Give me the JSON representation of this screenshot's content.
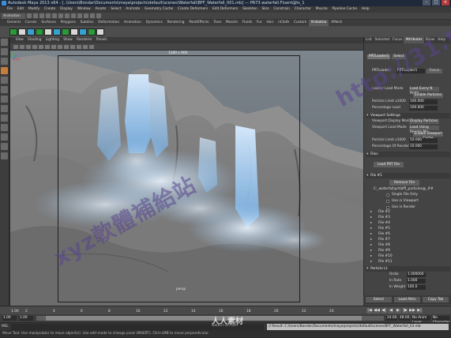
{
  "window": {
    "title": "Autodesk Maya 2013 x64 - [..\\Users\\Bondar\\Documents\\maya\\projects\\default\\scenes\\Waterfall\\BFF_Waterfall_001.mb] --- PR73.waterfall.Fluent@ts_1"
  },
  "menubar": [
    "File",
    "Edit",
    "Modify",
    "Create",
    "Display",
    "Window",
    "Assets",
    "Select",
    "Animate",
    "Geometry Cache",
    "Create Deformers",
    "Edit Deformers",
    "Skeleton",
    "Skin",
    "Constrain",
    "Character",
    "Muscle",
    "Pipeline Cache",
    "Help"
  ],
  "status_line": {
    "mode": "Animation"
  },
  "shelf_tabs": {
    "items": [
      "General",
      "Curves",
      "Surfaces",
      "Polygons",
      "Subdivs",
      "Deformation",
      "Animation",
      "Dynamics",
      "Rendering",
      "PaintEffects",
      "Toon",
      "Muscle",
      "Fluids",
      "Fur",
      "Hair",
      "nCloth",
      "Custom",
      "Krakatoa",
      "XMesh"
    ],
    "active_index": 17
  },
  "shelf_icon_colors": [
    "#2a9a3a",
    "#d8d8d8",
    "#3aa0d0",
    "#2a9a3a",
    "#d8d8d8",
    "#3aa0d0",
    "#2a9a3a",
    "#d8d8d8",
    "#3aa0d0",
    "#2a9a3a",
    "#d8d8d8"
  ],
  "viewport": {
    "menu": [
      "View",
      "Shading",
      "Lighting",
      "Show",
      "Renderer",
      "Panels"
    ],
    "resolution_label": "1280 x 960",
    "camera_label": "persp"
  },
  "attribute_editor": {
    "tabs": [
      "List",
      "Selected",
      "Focus",
      "Attributes",
      "Show",
      "Help"
    ],
    "active_tab": "Attributes",
    "node_tabs": [
      "PRTLoader1",
      "Select"
    ],
    "name_label": "PRTLoader:",
    "name_value": "PRTLoader1",
    "name_button": "Focus",
    "top_rows": [
      {
        "label": "Loader Load Mode",
        "type": "dropdown",
        "value": "Load Every N Partic"
      },
      {
        "label": "",
        "type": "button",
        "value": "Enable Particles"
      },
      {
        "label": "Particle Limit x1000",
        "type": "field",
        "value": "100.000"
      },
      {
        "label": "Percentage Load",
        "type": "field",
        "value": "100.000"
      }
    ],
    "viewport_section": {
      "title": "Viewport Settings",
      "rows": [
        {
          "label": "Viewport Display Mode",
          "type": "dropdown",
          "value": "Display Particles"
        },
        {
          "label": "Viewport Load Mode",
          "type": "dropdown",
          "value": "Load Using Render Mo"
        },
        {
          "label": "",
          "type": "button",
          "value": "Enable Viewport Cache"
        },
        {
          "label": "Particle Limit x1000",
          "type": "field",
          "value": "50.000"
        },
        {
          "label": "Percentage Of Render",
          "type": "field",
          "value": "10.000"
        }
      ]
    },
    "files_section": {
      "title": "Files",
      "load_button": "Load PRT File",
      "remove_button": "Remove PRT Files"
    },
    "file1": {
      "title": "File #1",
      "remove_button": "Remove File",
      "path": "C:_waterfall\\prt\\bffl_particles@_##",
      "checks": [
        "Single File Only",
        "Use in Viewport",
        "Use in Render"
      ]
    },
    "file_rows": [
      "File #2",
      "File #3",
      "File #4",
      "File #5",
      "File #6",
      "File #7",
      "File #8",
      "File #9",
      "File #10",
      "File #11"
    ],
    "particle_section": {
      "title": "Particle Lt",
      "rows": [
        {
          "label": "Ordia",
          "value": "1.000000"
        },
        {
          "label": "In Rate",
          "value": "1.000"
        },
        {
          "label": "In Weight",
          "value": "100.0"
        }
      ]
    },
    "bottom_buttons": [
      "Select",
      "Load Attrs",
      "Copy Tab"
    ]
  },
  "timeline": {
    "ticks": [
      "2",
      "4",
      "6",
      "8",
      "10",
      "12",
      "14",
      "16",
      "18",
      "20",
      "22",
      "24"
    ],
    "current_frame": "1.00",
    "playback_symbols": [
      "|◀",
      "◀◀",
      "◀|",
      "◀",
      "▶",
      "|▶",
      "▶▶",
      "▶|"
    ]
  },
  "range_slider": {
    "start": "1.00",
    "inner_start": "1.00",
    "inner_end": "24.00",
    "end": "48.00",
    "anim_layer": "No Anim Layer",
    "character": "No Character Set"
  },
  "command_line": {
    "label": "MEL",
    "result": "// Result: C:/Users/Bondar/Documents/maya/projects/default/scenes/BFF_Waterfall_03.mb"
  },
  "help_line": "Move Tool: Use manipulator to move object(s). Use edit mode to change pivot (INSERT). Ctrl+LMB to move perpendicular.",
  "watermarks": {
    "line1": "xyz軟體補給站",
    "line2": "http://31.to",
    "site_cn": "人人素材",
    "site_en": "www.rr-sc.com"
  }
}
